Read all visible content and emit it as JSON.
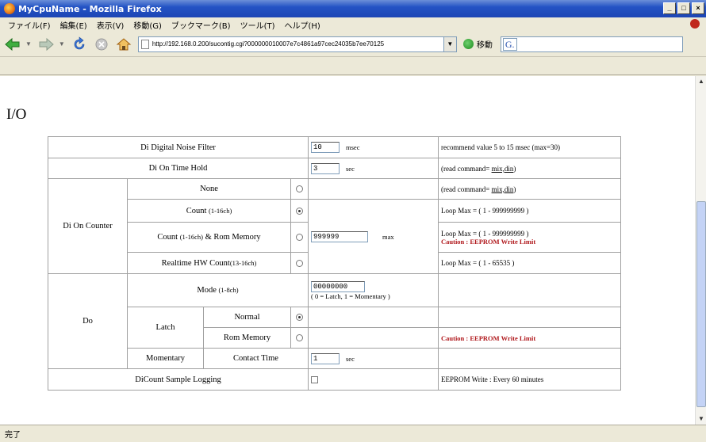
{
  "window": {
    "title": "MyCpuName - Mozilla Firefox",
    "buttons": [
      "_",
      "□",
      "×"
    ]
  },
  "menu": [
    "ファイル(F)",
    "編集(E)",
    "表示(V)",
    "移動(G)",
    "ブックマーク(B)",
    "ツール(T)",
    "ヘルプ(H)"
  ],
  "toolbar": {
    "url": "http://192.168.0.200/sucontig.cgi?000000010007e7c4861a97cec24035b7ee70125",
    "go_label": "移動",
    "search_icon": "G."
  },
  "page": {
    "heading": "I/O",
    "noise_filter": {
      "label": "Di Digital Noise Filter",
      "value": "10",
      "unit": "msec",
      "note": "recommend value 5 to 15 msec (max=30)"
    },
    "on_time_hold": {
      "label": "Di On Time Hold",
      "value": "3",
      "unit": "sec",
      "note_prefix": "(read command= ",
      "note_link": "mix,din",
      "note_suffix": ")"
    },
    "counter": {
      "group_label": "Di On Counter",
      "none_label": "None",
      "none_note_prefix": "(read command= ",
      "none_note_link": "mix,din",
      "none_note_suffix": ")",
      "count_label": "Count",
      "count_sub": "(1-16ch)",
      "count_note": "Loop Max = ( 1 - 999999999 )",
      "rom_label_a": "Count",
      "rom_sub": "(1-16ch)",
      "rom_label_b": "& Rom Memory",
      "rom_note": "Loop Max = ( 1 - 999999999 )",
      "rom_caution": "Caution : EEPROM Write Limit",
      "max_value": "999999",
      "max_unit": "max",
      "realtime_label": "Realtime HW Count",
      "realtime_sub": "(13-16ch)",
      "realtime_note": "Loop Max = ( 1 - 65535 )"
    },
    "do": {
      "group_label": "Do",
      "mode_label": "Mode",
      "mode_sub": "(1-8ch)",
      "mode_value": "00000000",
      "mode_hint": "( 0 = Latch, 1 = Momentary )",
      "latch_label": "Latch",
      "normal_label": "Normal",
      "rom_label": "Rom Memory",
      "rom_caution": "Caution : EEPROM Write Limit",
      "momentary_label": "Momentary",
      "contact_label": "Contact Time",
      "contact_value": "1",
      "contact_unit": "sec"
    },
    "logging": {
      "label": "DiCount Sample Logging",
      "note": "EEPROM Write : Every 60 minutes"
    }
  },
  "status": "完了"
}
